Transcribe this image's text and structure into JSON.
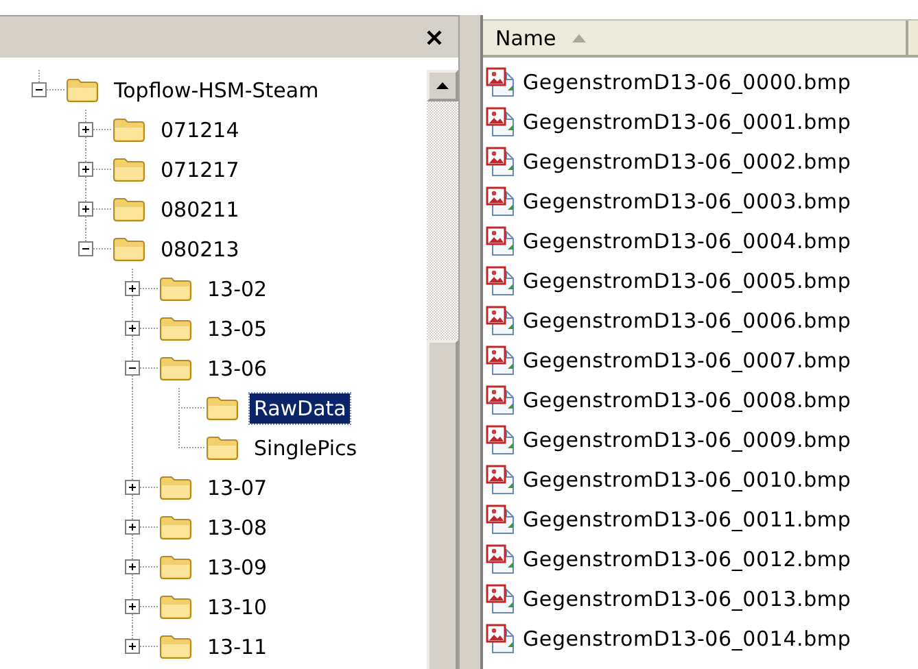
{
  "folder_pane": {
    "tree": [
      {
        "label": "Topflow-HSM-Steam",
        "expanded": true,
        "selected": false,
        "children": [
          {
            "label": "071214",
            "expanded": false,
            "selected": false
          },
          {
            "label": "071217",
            "expanded": false,
            "selected": false
          },
          {
            "label": "080211",
            "expanded": false,
            "selected": false
          },
          {
            "label": "080213",
            "expanded": true,
            "selected": false,
            "children": [
              {
                "label": "13-02",
                "expanded": false,
                "selected": false
              },
              {
                "label": "13-05",
                "expanded": false,
                "selected": false
              },
              {
                "label": "13-06",
                "expanded": true,
                "selected": false,
                "children": [
                  {
                    "label": "RawData",
                    "selected": true
                  },
                  {
                    "label": "SinglePics",
                    "selected": false
                  }
                ]
              },
              {
                "label": "13-07",
                "expanded": false,
                "selected": false
              },
              {
                "label": "13-08",
                "expanded": false,
                "selected": false
              },
              {
                "label": "13-09",
                "expanded": false,
                "selected": false
              },
              {
                "label": "13-10",
                "expanded": false,
                "selected": false
              },
              {
                "label": "13-11",
                "expanded": false,
                "selected": false
              }
            ]
          }
        ]
      }
    ]
  },
  "file_list": {
    "columns": [
      {
        "label": "Name",
        "sort_ascending": true
      }
    ],
    "files": [
      {
        "name": "GegenstromD13-06_0000.bmp",
        "selected": false
      },
      {
        "name": "GegenstromD13-06_0001.bmp",
        "selected": false
      },
      {
        "name": "GegenstromD13-06_0002.bmp",
        "selected": false
      },
      {
        "name": "GegenstromD13-06_0003.bmp",
        "selected": false
      },
      {
        "name": "GegenstromD13-06_0004.bmp",
        "selected": false
      },
      {
        "name": "GegenstromD13-06_0005.bmp",
        "selected": false
      },
      {
        "name": "GegenstromD13-06_0006.bmp",
        "selected": false
      },
      {
        "name": "GegenstromD13-06_0007.bmp",
        "selected": false
      },
      {
        "name": "GegenstromD13-06_0008.bmp",
        "selected": false
      },
      {
        "name": "GegenstromD13-06_0009.bmp",
        "selected": false
      },
      {
        "name": "GegenstromD13-06_0010.bmp",
        "selected": false
      },
      {
        "name": "GegenstromD13-06_0011.bmp",
        "selected": false
      },
      {
        "name": "GegenstromD13-06_0012.bmp",
        "selected": false
      },
      {
        "name": "GegenstromD13-06_0013.bmp",
        "selected": false
      },
      {
        "name": "GegenstromD13-06_0014.bmp",
        "selected": false
      }
    ]
  }
}
